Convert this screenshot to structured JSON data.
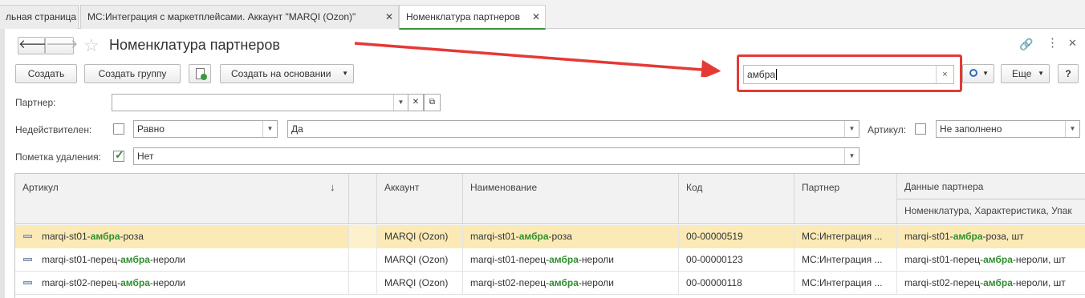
{
  "tabs": [
    {
      "label": "льная страница"
    },
    {
      "label": "МС:Интеграция с маркетплейсами. Аккаунт \"MARQI (Ozon)\""
    },
    {
      "label": "Номенклатура партнеров"
    }
  ],
  "window": {
    "title": "Номенклатура партнеров"
  },
  "toolbar": {
    "create": "Создать",
    "create_group": "Создать группу",
    "create_based": "Создать на основании",
    "more": "Еще",
    "help": "?"
  },
  "search": {
    "value": "амбра"
  },
  "filters": {
    "partner_label": "Партнер:",
    "partner_value": "",
    "invalid_label": "Недействителен:",
    "invalid_cond": "Равно",
    "invalid_value": "Да",
    "article_label": "Артикул:",
    "article_value": "Не заполнено",
    "deleted_label": "Пометка удаления:",
    "deleted_value": "Нет"
  },
  "table": {
    "columns": {
      "article": "Артикул",
      "account": "Аккаунт",
      "name": "Наименование",
      "code": "Код",
      "partner": "Партнер",
      "partner_data": "Данные партнера",
      "partner_data_sub": "Номенклатура, Характеристика, Упак"
    },
    "rows": [
      {
        "article": [
          "marqi-st01-",
          "амбра",
          "-роза"
        ],
        "account": "MARQI (Ozon)",
        "name": [
          "marqi-st01-",
          "амбра",
          "-роза"
        ],
        "code": "00-00000519",
        "partner": "МС:Интеграция ...",
        "pdata": [
          "marqi-st01-",
          "амбра",
          "-роза, шт"
        ],
        "selected": true
      },
      {
        "article": [
          "marqi-st01-перец-",
          "амбра",
          "-нероли"
        ],
        "account": "MARQI (Ozon)",
        "name": [
          "marqi-st01-перец-",
          "амбра",
          "-нероли"
        ],
        "code": "00-00000123",
        "partner": "МС:Интеграция ...",
        "pdata": [
          "marqi-st01-перец-",
          "амбра",
          "-нероли, шт"
        ],
        "selected": false
      },
      {
        "article": [
          "marqi-st02-перец-",
          "амбра",
          "-нероли"
        ],
        "account": "MARQI (Ozon)",
        "name": [
          "marqi-st02-перец-",
          "амбра",
          "-нероли"
        ],
        "code": "00-00000118",
        "partner": "МС:Интеграция ...",
        "pdata": [
          "marqi-st02-перец-",
          "амбра",
          "-нероли, шт"
        ],
        "selected": false
      }
    ]
  },
  "colors": {
    "accent": "#3f8f3f",
    "highlight": "#2f8f2f",
    "annotation": "#e53935",
    "selected_row": "#fbeab6"
  }
}
